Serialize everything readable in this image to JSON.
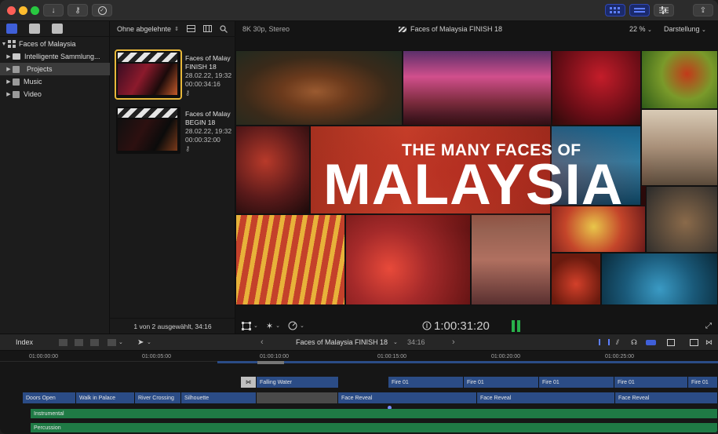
{
  "toolbar": {
    "import_icon": "↓",
    "keyword_icon": "⚷",
    "check_icon": "✓",
    "share_icon": "⇪"
  },
  "library": {
    "name": "Faces of Malaysia",
    "items": [
      {
        "label": "Intelligente Sammlung..."
      },
      {
        "label": "Projects"
      },
      {
        "label": "Music"
      },
      {
        "label": "Video"
      }
    ]
  },
  "browser": {
    "filter": "Ohne abgelehnte",
    "clips": [
      {
        "title1": "Faces of Malay",
        "title2": "FINISH 18",
        "date": "28.02.22, 19:32",
        "duration": "00:00:34:16"
      },
      {
        "title1": "Faces of Malay",
        "title2": "BEGIN 18",
        "date": "28.02.22, 19:32",
        "duration": "00:00:32:00"
      }
    ],
    "status": "1 von 2 ausgewählt, 34:16"
  },
  "viewer": {
    "format": "8K 30p, Stereo",
    "project": "Faces of Malaysia FINISH 18",
    "zoom": "22 %",
    "view_label": "Darstellung",
    "headline_small": "THE MANY FACES OF",
    "headline_big": "MALAYSIA",
    "timecode": "1:00:31:20"
  },
  "timeline": {
    "index_label": "Index",
    "project": "Faces of Malaysia FINISH 18",
    "duration": "34:16",
    "ruler": [
      "01:00:00:00",
      "01:00:05:00",
      "01:00:10:00",
      "01:00:15:00",
      "01:00:20:00",
      "01:00:25:00"
    ],
    "upper_clips": [
      {
        "label": "Falling Water"
      },
      {
        "label": "Fire 01"
      },
      {
        "label": "Fire 01"
      },
      {
        "label": "Fire 01"
      },
      {
        "label": "Fire 01"
      },
      {
        "label": "Fire 01"
      }
    ],
    "main_clips": [
      {
        "label": "Doors Open"
      },
      {
        "label": "Walk in Palace"
      },
      {
        "label": "River Crossing"
      },
      {
        "label": "Silhouette"
      },
      {
        "label": "Face Reveal"
      },
      {
        "label": "Face Reveal"
      },
      {
        "label": "Face Reveal"
      }
    ],
    "audio": [
      {
        "label": "Instrumental"
      },
      {
        "label": "Percussion"
      }
    ]
  }
}
